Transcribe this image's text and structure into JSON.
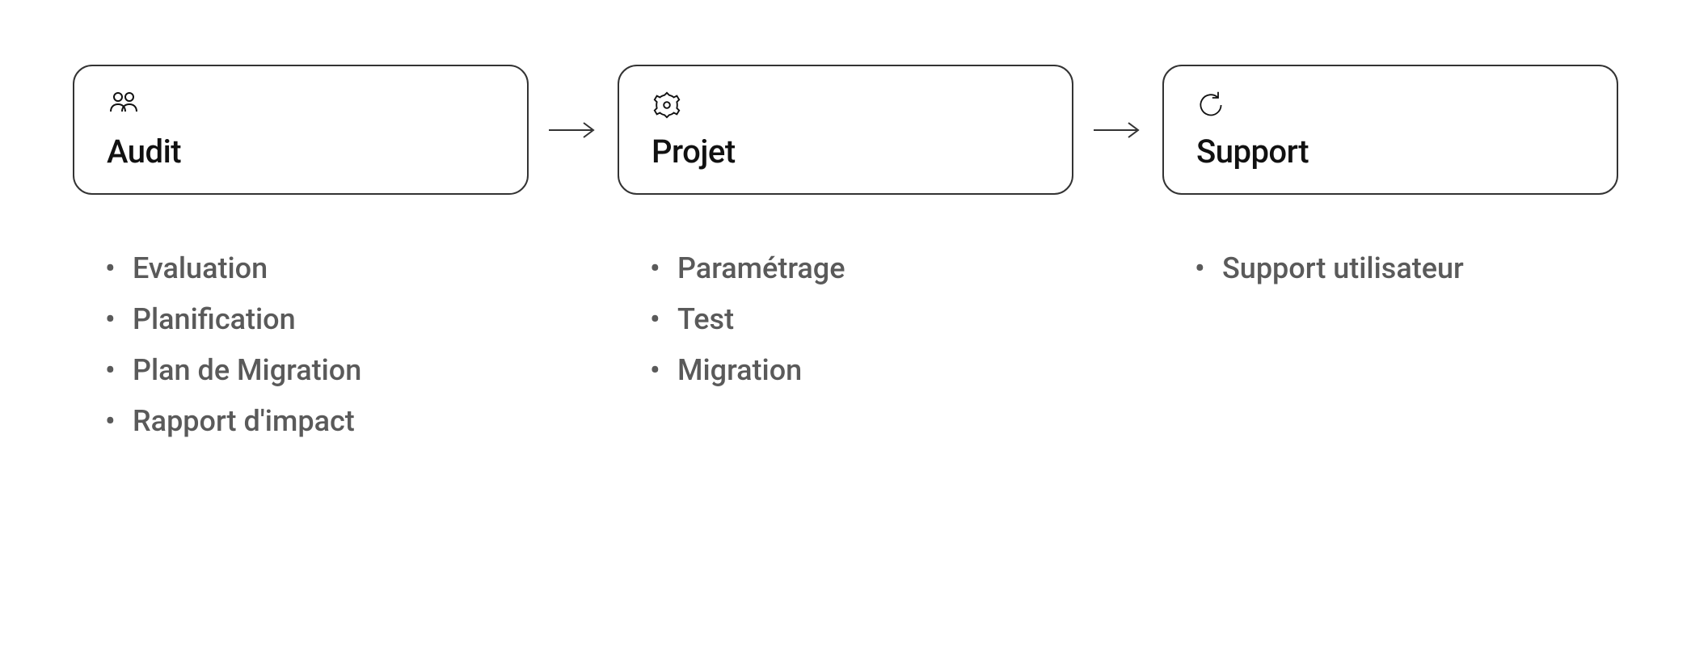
{
  "steps": [
    {
      "icon": "people-icon",
      "title": "Audit",
      "bullets": [
        "Evaluation",
        "Planification",
        "Plan de Migration",
        "Rapport d'impact"
      ]
    },
    {
      "icon": "gear-icon",
      "title": "Projet",
      "bullets": [
        "Paramétrage",
        "Test",
        "Migration"
      ]
    },
    {
      "icon": "refresh-icon",
      "title": "Support",
      "bullets": [
        "Support utilisateur"
      ]
    }
  ]
}
